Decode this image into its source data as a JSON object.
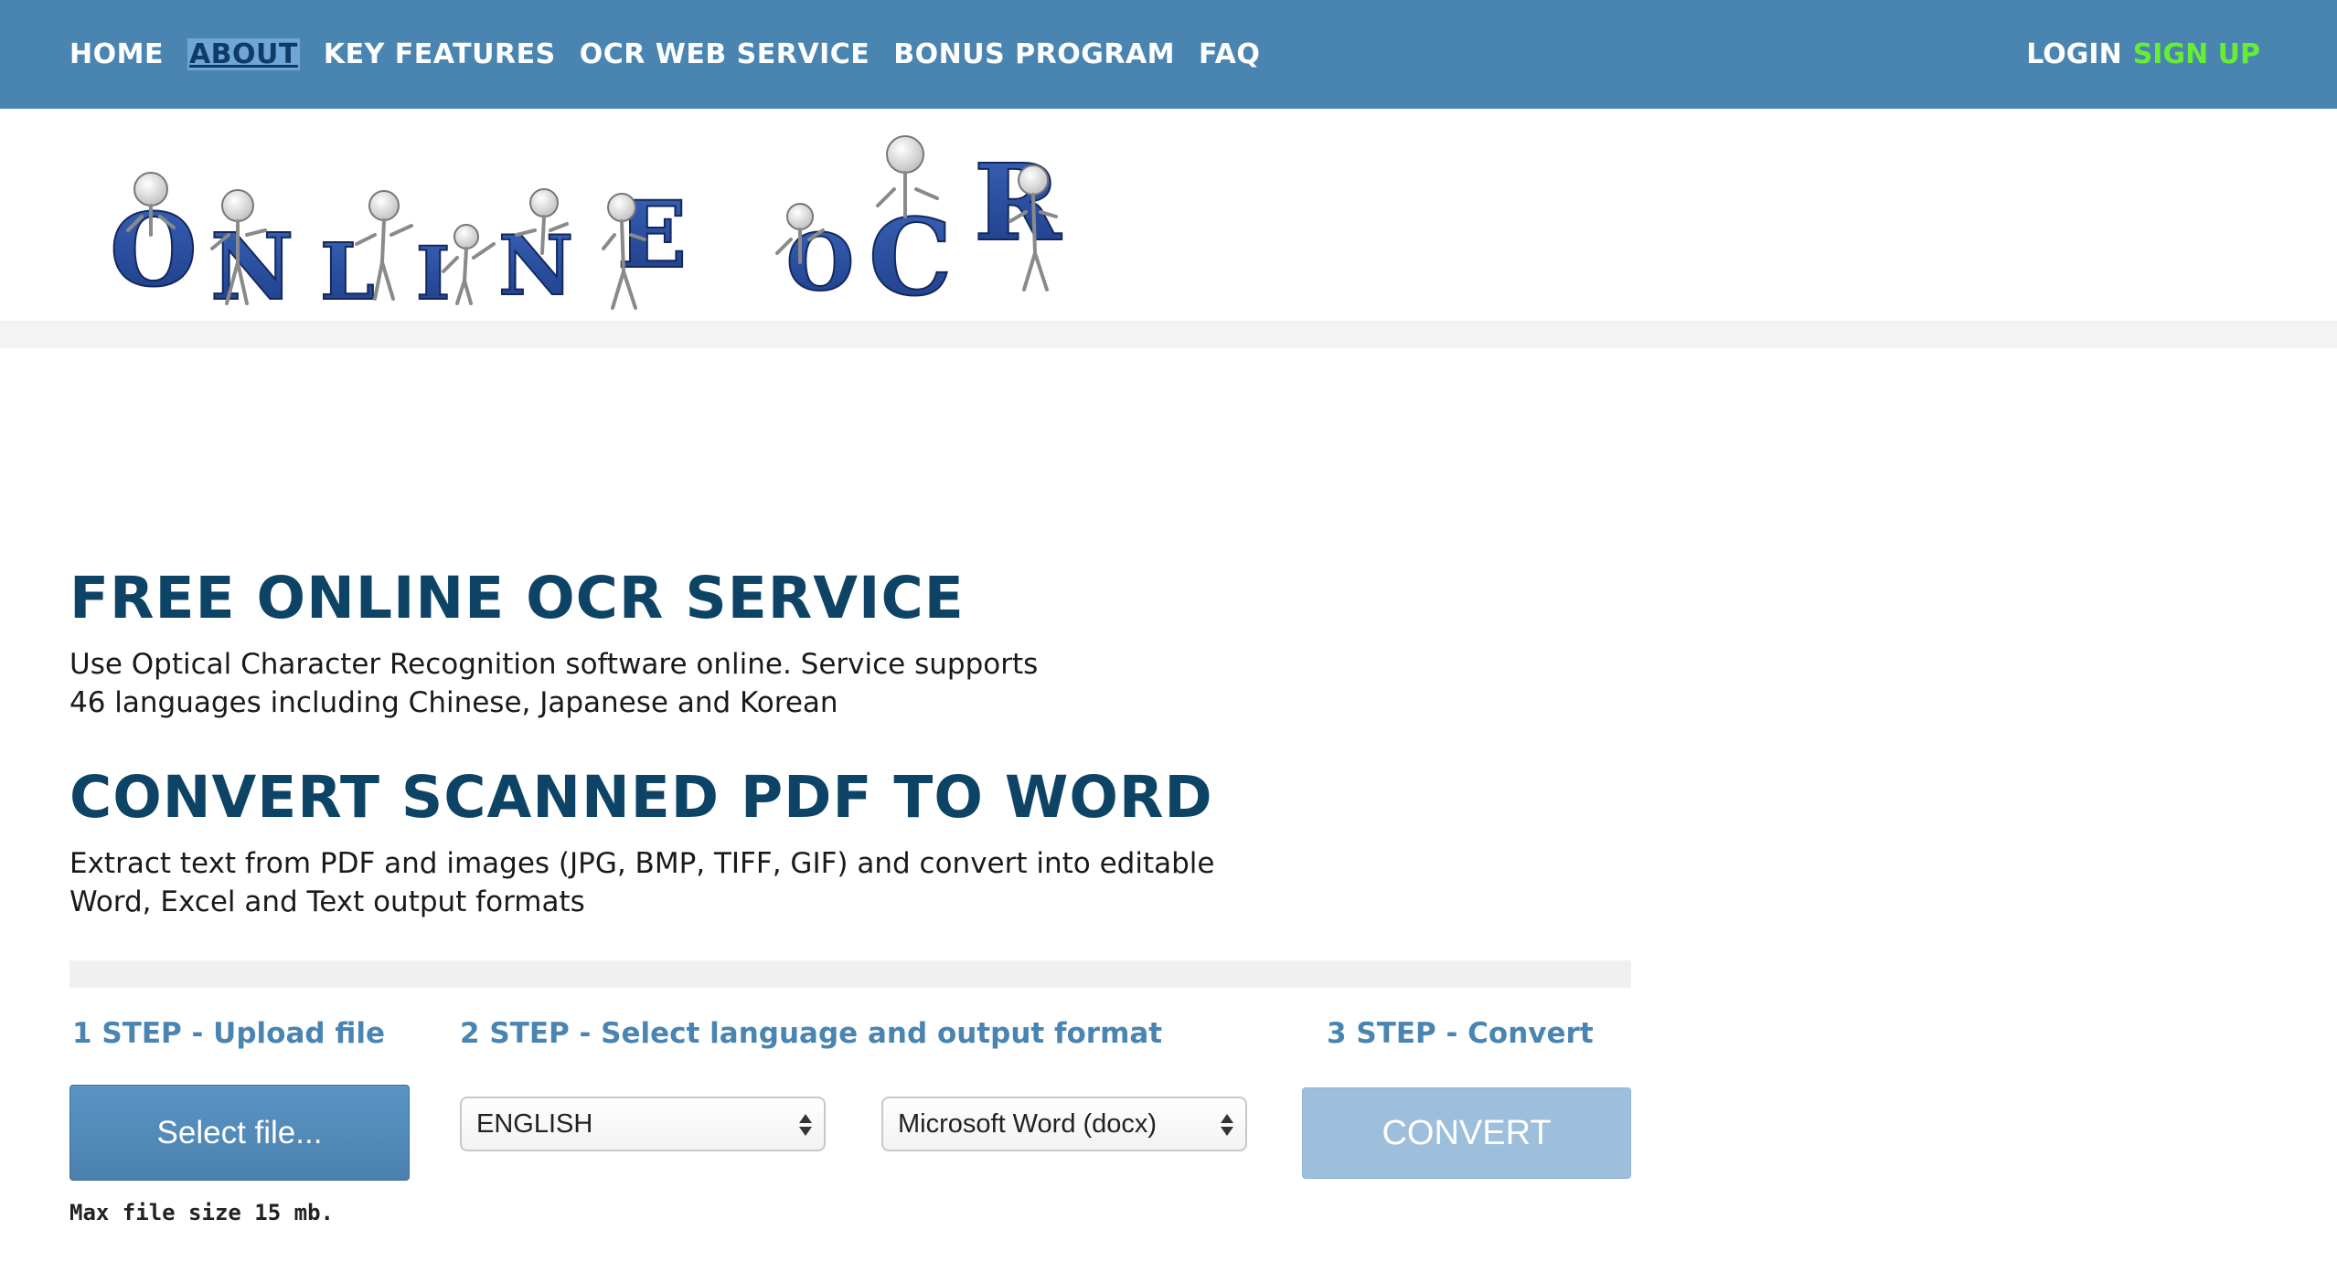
{
  "nav": {
    "items": [
      {
        "label": "HOME",
        "active": false
      },
      {
        "label": "ABOUT",
        "active": true
      },
      {
        "label": "KEY FEATURES",
        "active": false
      },
      {
        "label": "OCR WEB SERVICE",
        "active": false
      },
      {
        "label": "BONUS PROGRAM",
        "active": false
      },
      {
        "label": "FAQ",
        "active": false
      }
    ],
    "login": "LOGIN",
    "signup": "SIGN UP"
  },
  "logo": {
    "letters": [
      "O",
      "N",
      "L",
      "I",
      "N",
      "E",
      "O",
      "C",
      "R"
    ],
    "colors": {
      "letter": "#2a4f9e",
      "robot": "#b9b9b9"
    }
  },
  "main": {
    "heading1": "FREE ONLINE OCR SERVICE",
    "para1_line1": "Use Optical Character Recognition software online. Service supports",
    "para1_line2": "46 languages including Chinese, Japanese and Korean",
    "heading2": "CONVERT SCANNED PDF TO WORD",
    "para2_line1": "Extract text from PDF and images (JPG, BMP, TIFF, GIF) and convert into editable",
    "para2_line2": "Word, Excel and Text output formats"
  },
  "steps": {
    "step1": "1 STEP - Upload file",
    "step2": "2 STEP - Select language and output format",
    "step3": "3 STEP - Convert",
    "select_file": "Select file...",
    "max_size": "Max file size 15 mb.",
    "language": "ENGLISH",
    "format": "Microsoft Word (docx)",
    "convert": "CONVERT"
  },
  "colors": {
    "nav_bg": "#4a85b2",
    "heading": "#0d4466",
    "step_label": "#4a85b2",
    "signup": "#66ee33",
    "convert_btn": "#9dbfdb"
  }
}
